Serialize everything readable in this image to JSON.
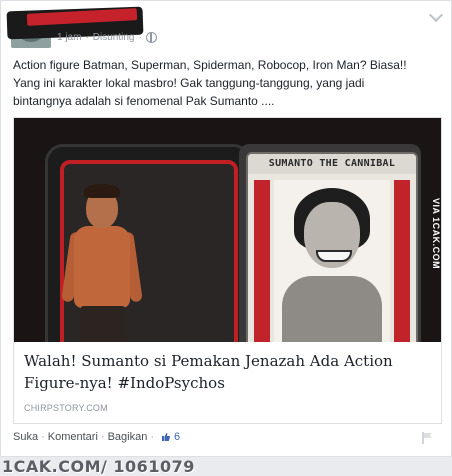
{
  "post": {
    "author_redacted": true,
    "time": "1 jam",
    "edited": "Disunting",
    "audience_icon": "globe-icon",
    "text_lines": [
      "Action figure Batman, Superman, Spiderman, Robocop, Iron Man? Biasa!!",
      "Yang ini karakter lokal masbro! Gak tanggung-tanggung, yang jadi",
      "bintangnya adalah si fenomenal Pak Sumanto ...."
    ]
  },
  "link": {
    "image_card_title": "SUMANTO THE CANNIBAL",
    "image_watermark": "VIA 1CAK.COM",
    "title_line1": "Walah! Sumanto si Pemakan Jenazah Ada Action",
    "title_line2": "Figure-nya! #IndoPsychos",
    "domain": "CHIRPSTORY.COM"
  },
  "actions": {
    "like": "Suka",
    "comment": "Komentari",
    "share": "Bagikan",
    "separator": "·",
    "like_count": "6"
  },
  "footer": {
    "brand": "1CAK.COM/ 1061079"
  },
  "colors": {
    "text": "#1d2129",
    "meta": "#9197a3",
    "link_blue": "#4267b2",
    "blister_red": "#c21f24"
  }
}
